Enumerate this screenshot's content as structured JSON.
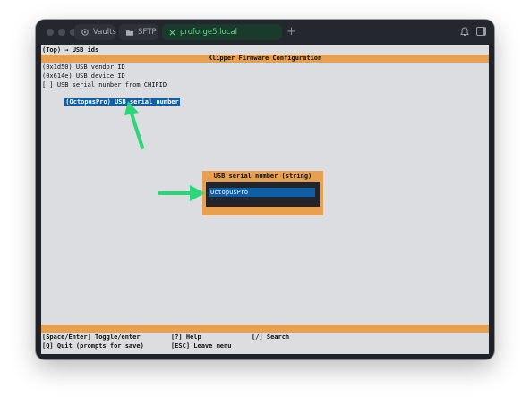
{
  "tabs": [
    {
      "label": "Vaults",
      "icon": "vault-icon"
    },
    {
      "label": "SFTP",
      "icon": "folder-icon"
    },
    {
      "label": "proforge5.local",
      "icon": "close-icon"
    }
  ],
  "breadcrumb": "(Top) → USB ids",
  "header_title": "Klipper Firmware Configuration",
  "menu": [
    {
      "text": "(0x1d50) USB vendor ID"
    },
    {
      "text": "(0x614e) USB device ID"
    },
    {
      "text": "[ ] USB serial number from CHIPID"
    },
    {
      "text": "(OctopusPro) USB serial number",
      "selected": true
    }
  ],
  "dialog": {
    "title": "USB serial number (string)",
    "value": "OctopusPro"
  },
  "help": {
    "toggle": "[Space/Enter] Toggle/enter",
    "help": "[?] Help",
    "search": "[/] Search",
    "quit": "[Q] Quit (prompts for save)",
    "leave": "[ESC] Leave menu"
  },
  "colors": {
    "accent_orange": "#e6a050",
    "selection_blue": "#0f5fa6",
    "annotation_arrow": "#2ed47a",
    "terminal_bg": "#dcdde1"
  }
}
